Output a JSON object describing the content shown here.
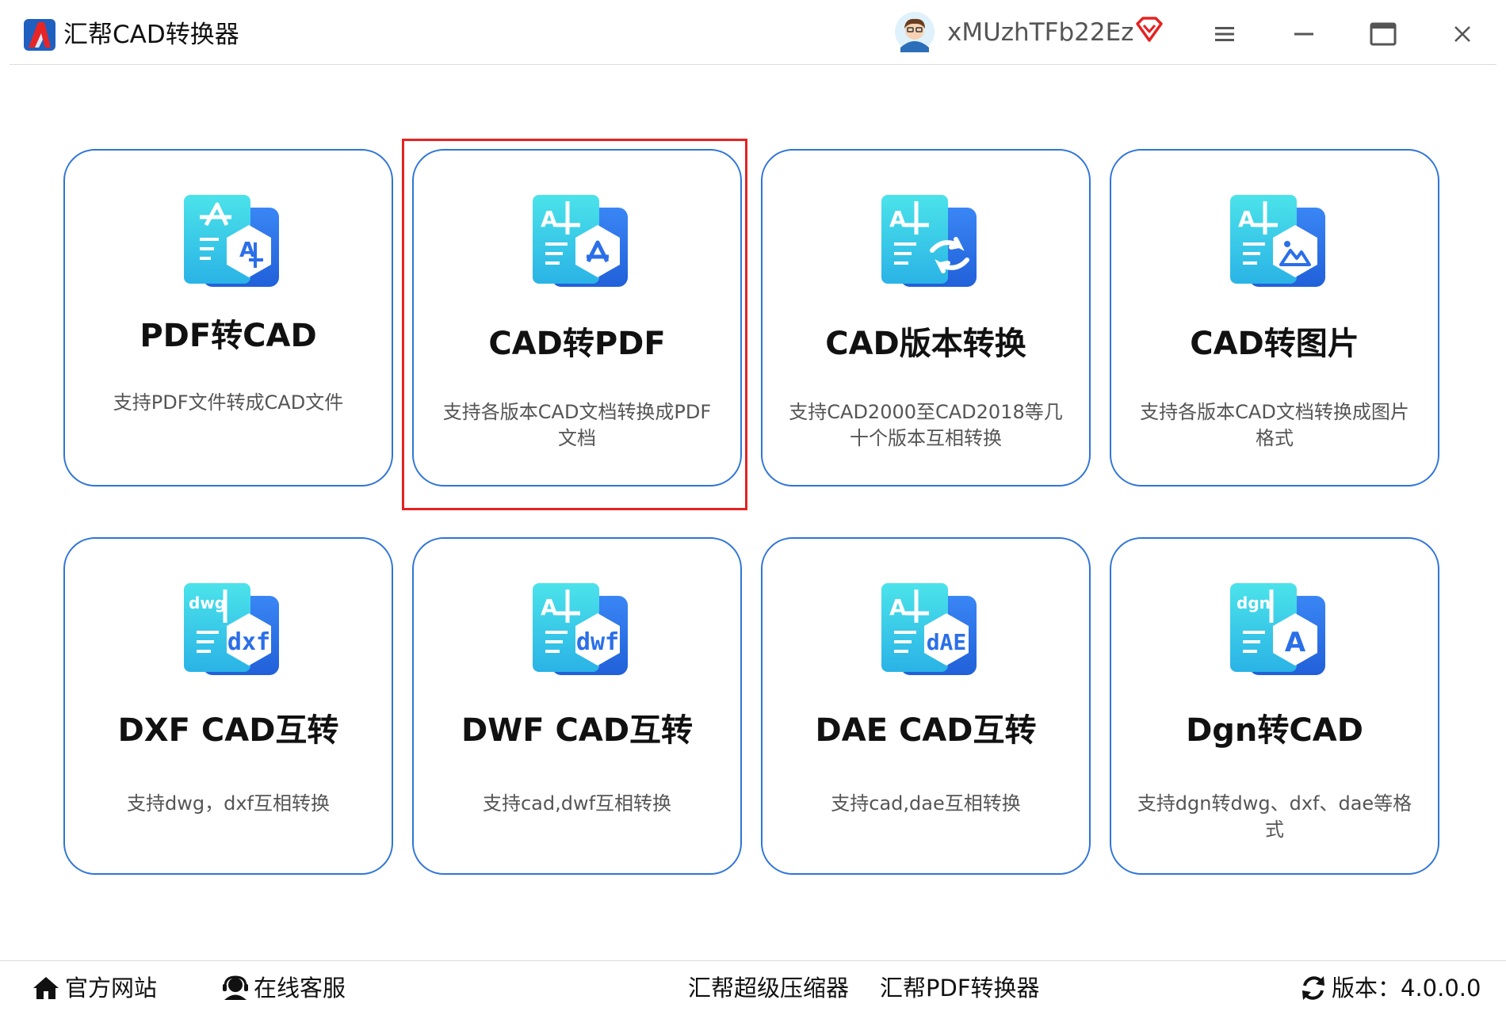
{
  "app": {
    "title": "汇帮CAD转换器",
    "username": "xMUzhTFb22Ez"
  },
  "icons": {
    "logo": "autocad-a-icon",
    "avatar": "user-avatar-icon",
    "vip": "vip-diamond-icon",
    "menu": "menu-icon",
    "minimize": "minimize-icon",
    "maximize": "maximize-icon",
    "close": "close-icon",
    "home": "home-icon",
    "service": "headset-icon",
    "refresh": "refresh-icon"
  },
  "colors": {
    "accent": "#2f75d8",
    "selection": "#e52222",
    "icon_cyan": "#35d3e2",
    "icon_blue": "#2b6fe8"
  },
  "cards": [
    {
      "title": "PDF转CAD",
      "desc": "支持PDF文件转成CAD文件",
      "badge": ""
    },
    {
      "title": "CAD转PDF",
      "desc": "支持各版本CAD文档转换成PDF文档",
      "badge": ""
    },
    {
      "title": "CAD版本转换",
      "desc": "支持CAD2000至CAD2018等几十个版本互相转换",
      "badge": ""
    },
    {
      "title": "CAD转图片",
      "desc": "支持各版本CAD文档转换成图片格式",
      "badge": ""
    },
    {
      "title": "DXF CAD互转",
      "desc": "支持dwg，dxf互相转换",
      "badge_top": "dwg",
      "badge": "dxf"
    },
    {
      "title": "DWF CAD互转",
      "desc": "支持cad,dwf互相转换",
      "badge_top": "A",
      "badge": "dwf"
    },
    {
      "title": "DAE CAD互转",
      "desc": "支持cad,dae互相转换",
      "badge_top": "A",
      "badge": "dAE"
    },
    {
      "title": "Dgn转CAD",
      "desc": "支持dgn转dwg、dxf、dae等格式",
      "badge_top": "dgn",
      "badge": "A"
    }
  ],
  "footer": {
    "site": "官方网站",
    "service": "在线客服",
    "compressor": "汇帮超级压缩器",
    "pdf_converter": "汇帮PDF转换器",
    "version": "版本：4.0.0.0"
  }
}
